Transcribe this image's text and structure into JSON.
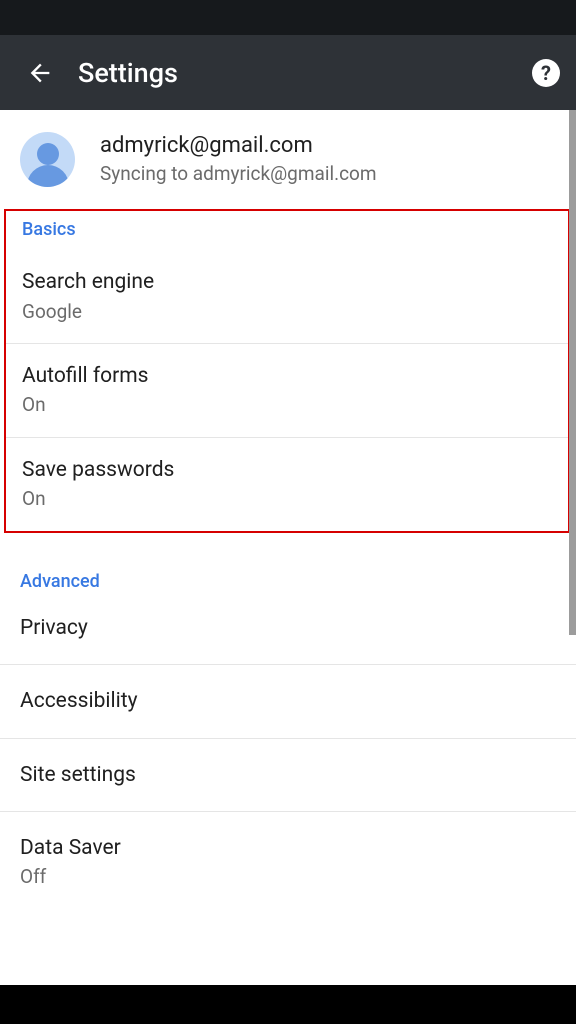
{
  "header": {
    "title": "Settings"
  },
  "account": {
    "email": "admyrick@gmail.com",
    "sync_status": "Syncing to admyrick@gmail.com"
  },
  "sections": {
    "basics": {
      "header": "Basics",
      "items": [
        {
          "label": "Search engine",
          "value": "Google"
        },
        {
          "label": "Autofill forms",
          "value": "On"
        },
        {
          "label": "Save passwords",
          "value": "On"
        }
      ]
    },
    "advanced": {
      "header": "Advanced",
      "items": [
        {
          "label": "Privacy",
          "value": ""
        },
        {
          "label": "Accessibility",
          "value": ""
        },
        {
          "label": "Site settings",
          "value": ""
        },
        {
          "label": "Data Saver",
          "value": "Off"
        }
      ]
    }
  }
}
